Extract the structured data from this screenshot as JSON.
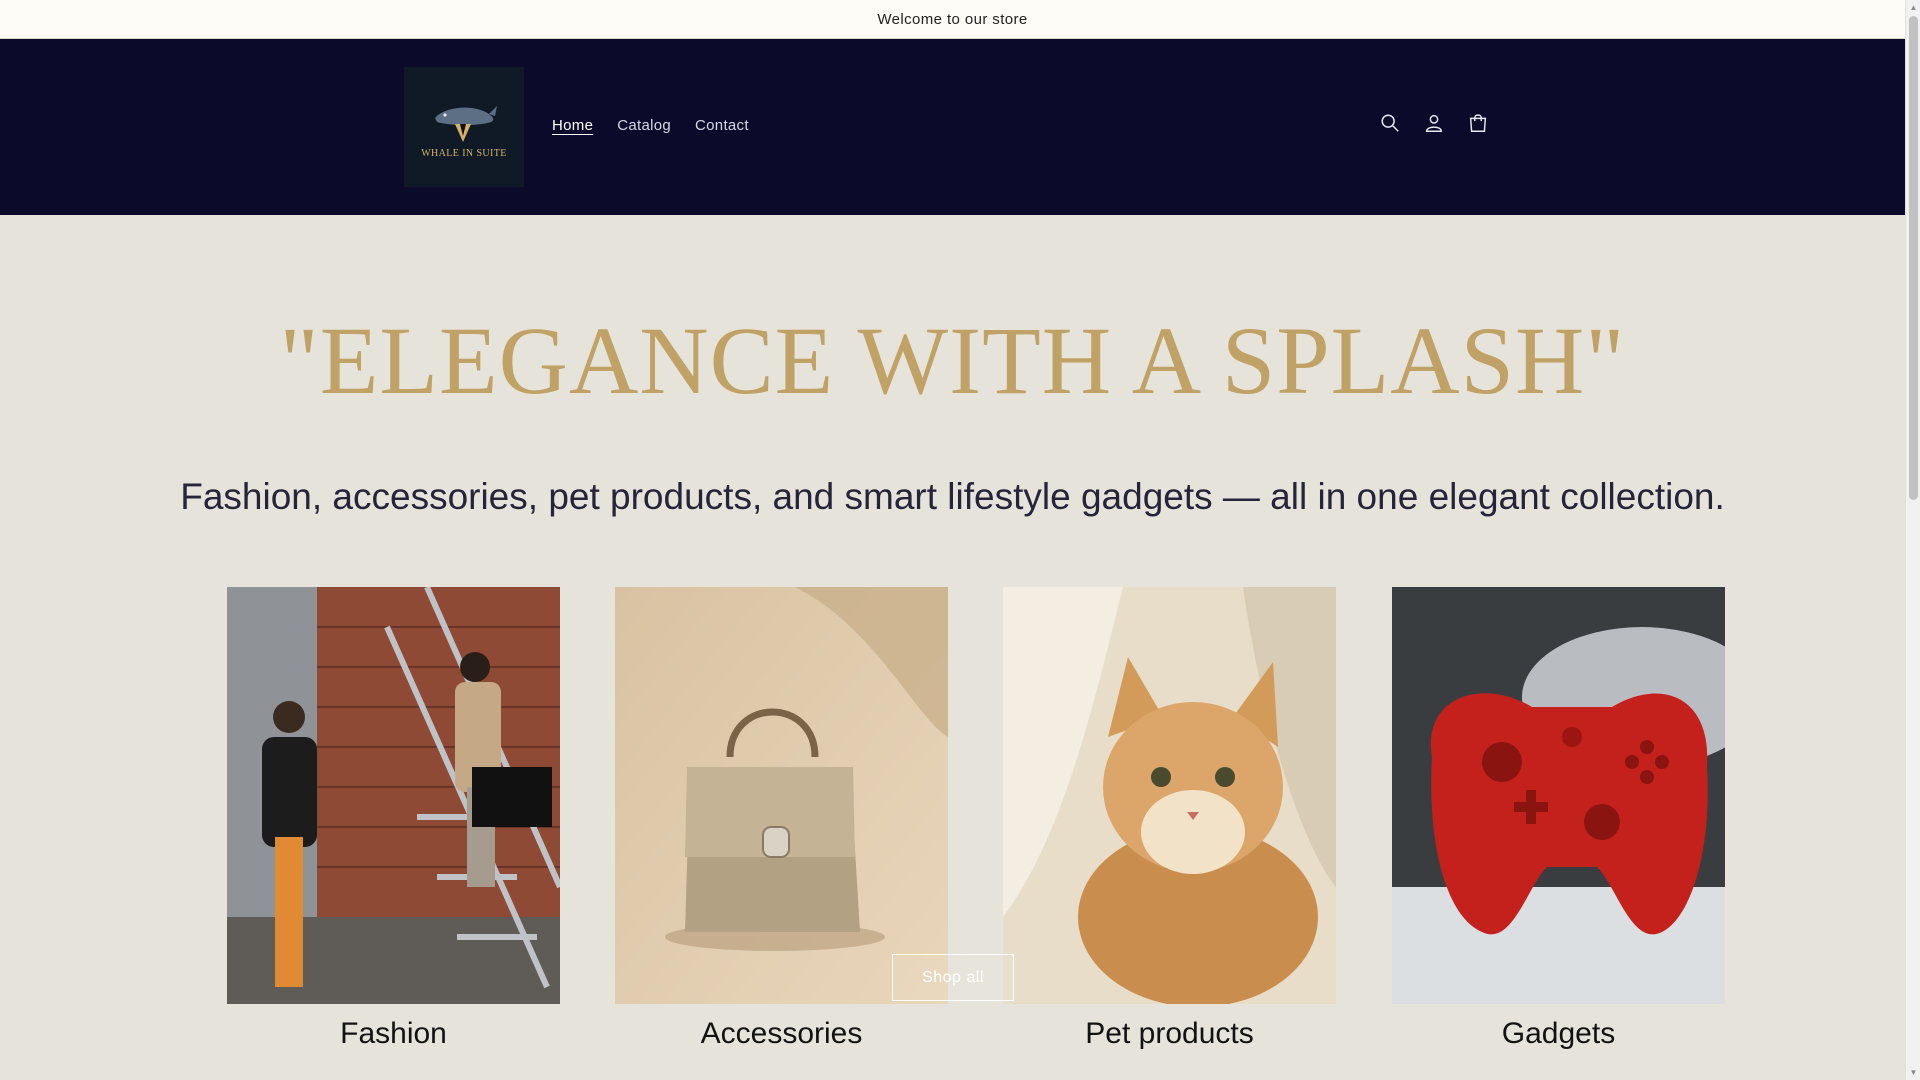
{
  "announcement": {
    "text": "Welcome to our store"
  },
  "header": {
    "logo_text": "WHALE IN SUITE",
    "nav": [
      {
        "label": "Home",
        "active": true
      },
      {
        "label": "Catalog",
        "active": false
      },
      {
        "label": "Contact",
        "active": false
      }
    ],
    "icons": [
      "search-icon",
      "account-icon",
      "cart-icon"
    ]
  },
  "hero": {
    "title": "\"ELEGANCE WITH A SPLASH\"",
    "subtitle": "Fashion, accessories, pet products, and smart lifestyle gadgets — all in one elegant collection."
  },
  "collections": [
    {
      "label": "Fashion"
    },
    {
      "label": "Accessories"
    },
    {
      "label": "Pet products"
    },
    {
      "label": "Gadgets"
    }
  ],
  "cta": {
    "label": "Shop all"
  },
  "colors": {
    "header_bg": "#0b0a2a",
    "page_bg": "#e6e3da",
    "title_gold": "#c0a266",
    "announcement_bg": "#fdfcf6"
  }
}
